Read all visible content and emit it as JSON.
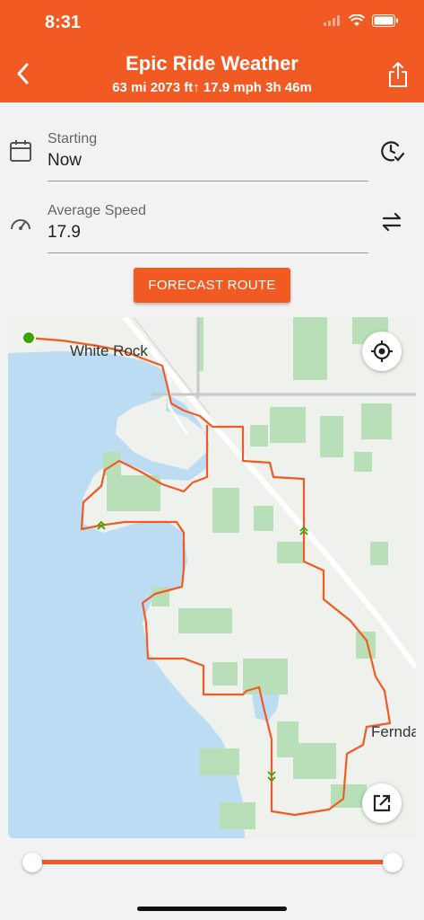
{
  "status_bar": {
    "time": "8:31"
  },
  "header": {
    "title": "Epic Ride Weather",
    "stats": "63 mi  2073 ft↑  17.9 mph  3h 46m"
  },
  "starting": {
    "label": "Starting",
    "value": "Now"
  },
  "average_speed": {
    "label": "Average Speed",
    "value": "17.9"
  },
  "forecast_button": {
    "label": "FORECAST ROUTE"
  },
  "map": {
    "labels": {
      "white_rock": "White Rock",
      "ferndale": "Fernda"
    }
  },
  "time_slider": {
    "start_fraction": 0.0,
    "end_fraction": 1.0
  },
  "colors": {
    "accent": "#f15a22",
    "water": "#bcdcf3",
    "park": "#b8dfb8",
    "route": "#f15a22"
  }
}
